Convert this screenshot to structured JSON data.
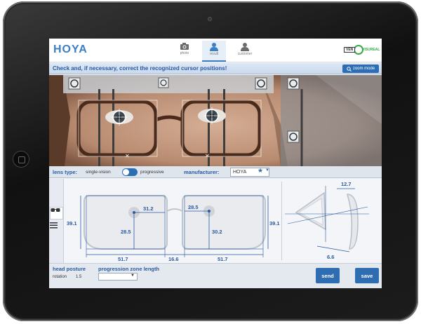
{
  "header": {
    "logo": "HOYA",
    "tabs": [
      {
        "label": "photo",
        "icon": "camera-icon",
        "active": false
      },
      {
        "label": "result",
        "icon": "person-icon",
        "active": true
      },
      {
        "label": "customer",
        "icon": "person-icon",
        "active": false
      }
    ],
    "partner_logo": {
      "box": "VEN",
      "text": "VISUREAL"
    }
  },
  "instruction": {
    "text": "Check and, if necessary, correct the recognized cursor positions!",
    "zoom_button": "zoom mode"
  },
  "lens_bar": {
    "lens_type_label": "lens type:",
    "option_single": "single-vision",
    "option_progressive": "progressive",
    "toggle_state": "progressive",
    "manufacturer_label": "manufacturer:",
    "manufacturer_value": "HOYA"
  },
  "measurements": {
    "right_height": "39.1",
    "right_pd": "31.2",
    "right_fitting_height": "28.5",
    "right_width": "51.7",
    "bridge": "16.6",
    "left_pd": "28.5",
    "left_fitting_height": "30.2",
    "left_width": "51.7",
    "left_height": "39.1",
    "vertex_distance": "12.7",
    "pantoscopic_tilt": "6.6"
  },
  "bottom": {
    "head_posture_label": "head posture",
    "rotation_label": "rotation",
    "rotation_value": "1.5",
    "progression_label": "progression zone length",
    "progression_value": "",
    "send_button": "send",
    "save_button": "save"
  },
  "colors": {
    "accent": "#2f6db3",
    "label_blue": "#2a5aa0",
    "partner_green": "#39a84a"
  }
}
